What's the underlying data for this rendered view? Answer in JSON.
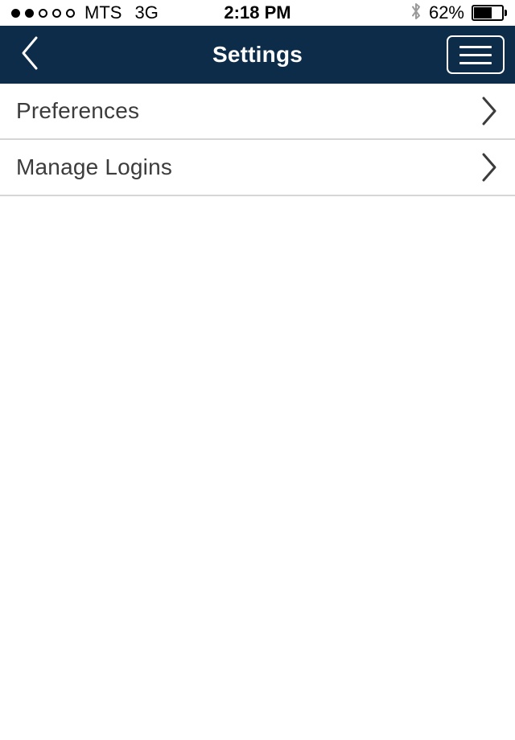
{
  "status_bar": {
    "signal_dots_filled": 2,
    "signal_dots_total": 5,
    "carrier": "MTS",
    "network": "3G",
    "time": "2:18 PM",
    "bluetooth_icon": "bluetooth-icon",
    "battery_percent_label": "62%",
    "battery_level": 62
  },
  "nav_bar": {
    "back_icon": "chevron-left-icon",
    "title": "Settings",
    "menu_icon": "hamburger-menu-icon",
    "background_color": "#0d2c4a",
    "text_color": "#ffffff"
  },
  "list": {
    "rows": [
      {
        "label": "Preferences",
        "accessory_icon": "chevron-right-icon"
      },
      {
        "label": "Manage Logins",
        "accessory_icon": "chevron-right-icon"
      }
    ]
  },
  "colors": {
    "navy": "#0d2c4a",
    "divider": "#d6d6d6",
    "row_text": "#3c3c3c",
    "background": "#ffffff"
  }
}
